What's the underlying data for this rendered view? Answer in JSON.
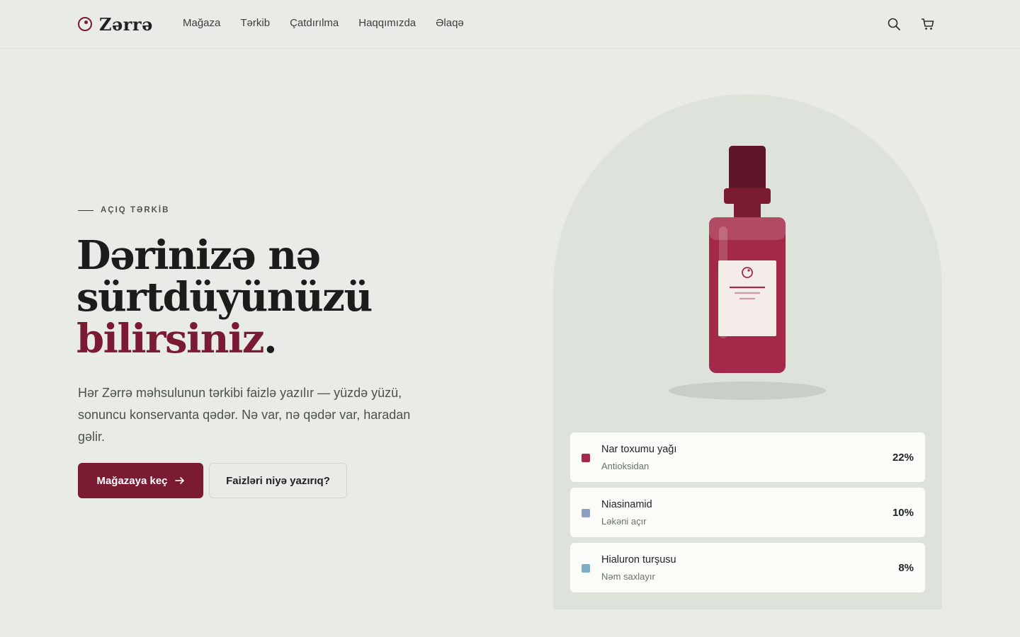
{
  "header": {
    "brand": "Zərrə",
    "nav": [
      "Mağaza",
      "Tərkib",
      "Çatdırılma",
      "Haqqımızda",
      "Əlaqə"
    ]
  },
  "hero": {
    "eyebrow": "AÇIQ TƏRKİB",
    "headline_line1": "Dərinizə nə",
    "headline_line2": "sürtdüyünüzü",
    "headline_accent": "bilirsiniz",
    "headline_period": ".",
    "lead": "Hər Zərrə məhsulunun tərkibi faizlə yazılır — yüzdə yüzü, sonuncu konservanta qədər. Nə var, nə qədər var, haradan gəlir.",
    "cta_primary": "Mağazaya keç",
    "cta_secondary": "Faizləri niyə yazırıq?"
  },
  "ingredients": [
    {
      "name": "Nar toxumu yağı",
      "role": "Antioksidan",
      "percent": "22%",
      "color": "#a3284a"
    },
    {
      "name": "Niasinamid",
      "role": "Ləkəni açır",
      "percent": "10%",
      "color": "#8f9fc4"
    },
    {
      "name": "Hialuron turşusu",
      "role": "Nəm saxlayır",
      "percent": "8%",
      "color": "#7daec6"
    }
  ],
  "colors": {
    "brand": "#7a1b33",
    "background": "#e9ece6",
    "arch": "#dde3da",
    "bottle": "#a3284a"
  },
  "icons": {
    "search": "search-icon",
    "cart": "cart-icon",
    "arrow": "arrow-right-icon"
  }
}
